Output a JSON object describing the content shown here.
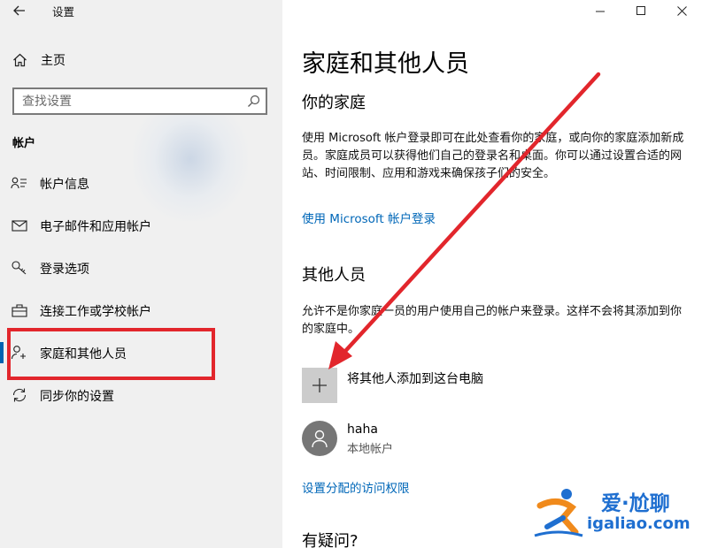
{
  "app": {
    "title": "设置"
  },
  "sidebar": {
    "home_label": "主页",
    "search_placeholder": "查找设置",
    "section_label": "帐户",
    "items": [
      {
        "label": "帐户信息",
        "icon": "person-card-icon"
      },
      {
        "label": "电子邮件和应用帐户",
        "icon": "mail-icon"
      },
      {
        "label": "登录选项",
        "icon": "key-icon"
      },
      {
        "label": "连接工作或学校帐户",
        "icon": "briefcase-icon"
      },
      {
        "label": "家庭和其他人员",
        "icon": "person-add-icon",
        "active": true
      },
      {
        "label": "同步你的设置",
        "icon": "sync-icon"
      }
    ]
  },
  "main": {
    "title": "家庭和其他人员",
    "family": {
      "heading": "你的家庭",
      "description": "使用 Microsoft 帐户登录即可在此处查看你的家庭，或向你的家庭添加新成员。家庭成员可以获得他们自己的登录名和桌面。你可以通过设置合适的网站、时间限制、应用和游戏来确保孩子们的安全。",
      "link": "使用 Microsoft 帐户登录"
    },
    "others": {
      "heading": "其他人员",
      "description": "允许不是你家庭一员的用户使用自己的帐户来登录。这样不会将其添加到你的家庭中。",
      "add_label": "将其他人添加到这台电脑",
      "user": {
        "name": "haha",
        "type": "本地帐户"
      },
      "access_link": "设置分配的访问权限"
    },
    "question_heading": "有疑问?"
  },
  "watermark": {
    "text_cn": "爱·尬聊",
    "url": "igaliao.com"
  },
  "colors": {
    "accent": "#0063b1",
    "link": "#0067b8",
    "annotation": "#e2262c",
    "sidebar_bg": "#f0f0f0"
  }
}
